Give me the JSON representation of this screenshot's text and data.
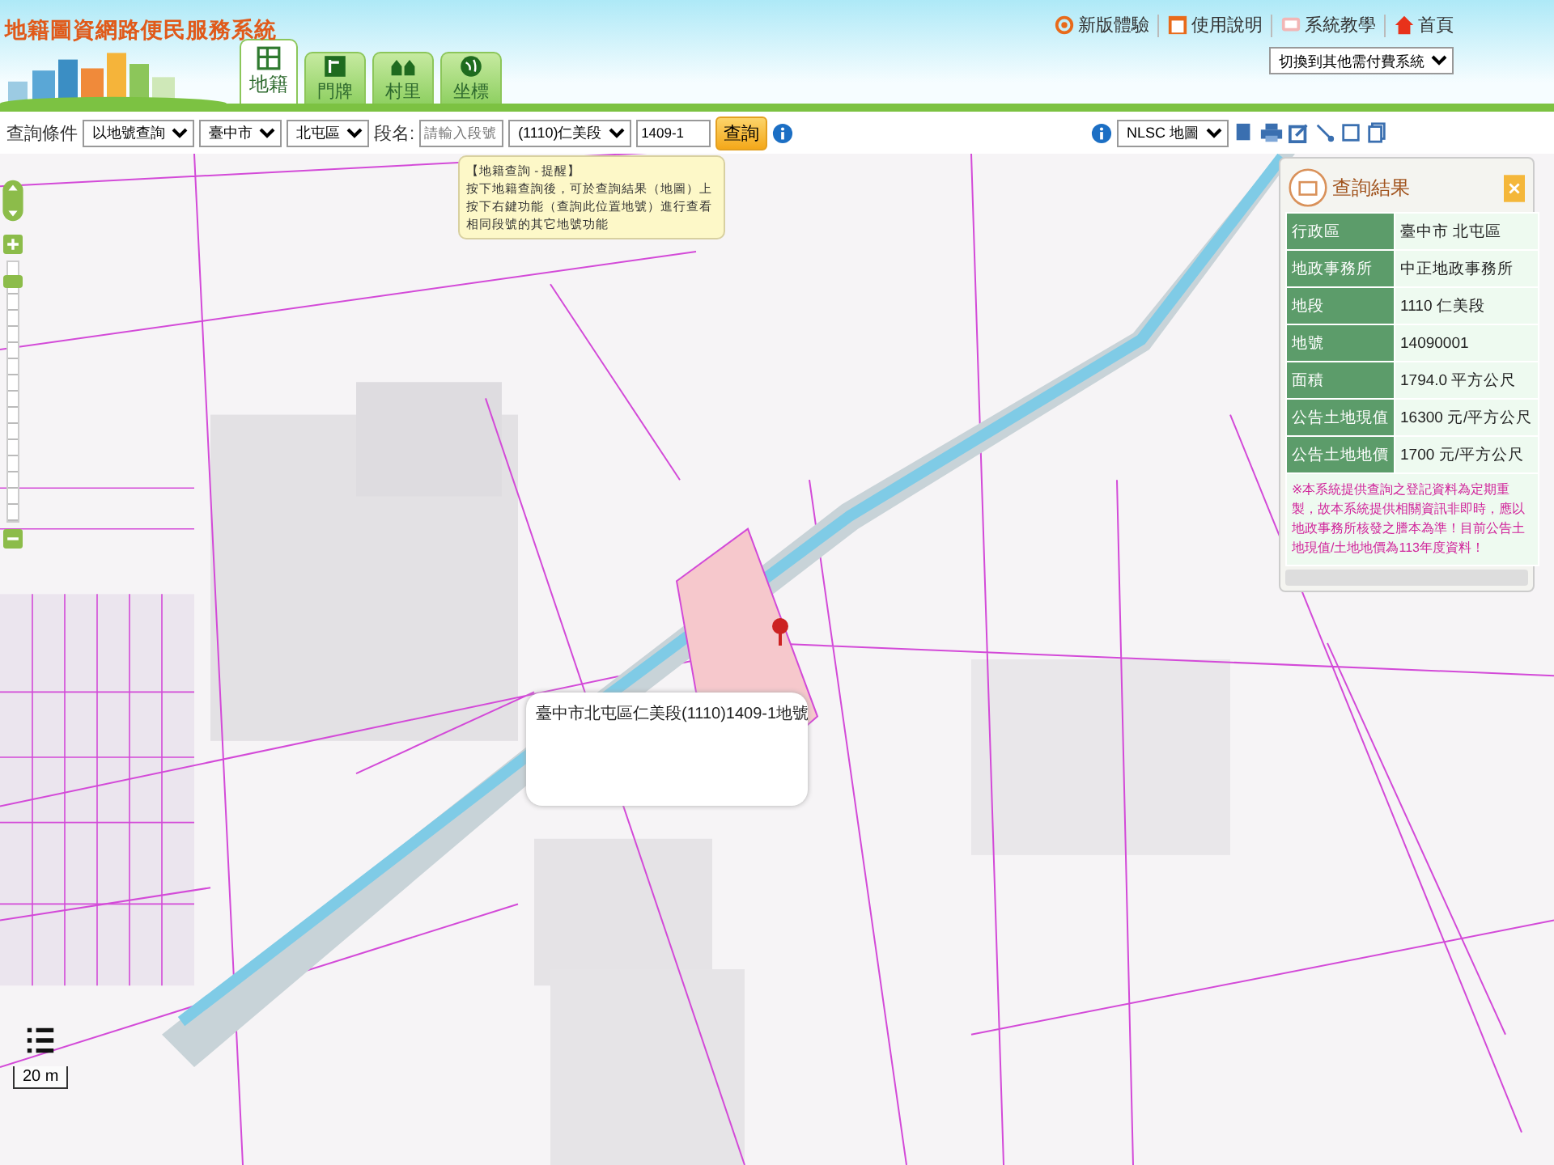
{
  "header": {
    "title": "地籍圖資網路便民服務系統",
    "links": [
      {
        "kind": "new",
        "label": "新版體驗"
      },
      {
        "kind": "help",
        "label": "使用說明"
      },
      {
        "kind": "tutorial",
        "label": "系統教學"
      },
      {
        "kind": "home",
        "label": "首頁"
      }
    ],
    "system_select": "切換到其他需付費系統"
  },
  "tabs": [
    {
      "kind": "parcel",
      "label": "地籍",
      "selected": true
    },
    {
      "kind": "doorplate",
      "label": "門牌",
      "selected": false
    },
    {
      "kind": "village",
      "label": "村里",
      "selected": false
    },
    {
      "kind": "coordinate",
      "label": "坐標",
      "selected": false
    }
  ],
  "query_bar": {
    "label": "查詢條件",
    "mode": "以地號查詢",
    "city": "臺中市",
    "district": "北屯區",
    "section_label": "段名:",
    "section_placeholder": "請輸入段號",
    "section": "(1110)仁美段",
    "parcel": "1409-1",
    "button": "查詢"
  },
  "basemap": "NLSC 地圖",
  "tooltip": {
    "title": "【地籍查詢 - 提醒】",
    "text": "按下地籍查詢後，可於查詢結果（地圖）上按下右鍵功能（查詢此位置地號）進行查看相同段號的其它地號功能"
  },
  "results": {
    "title": "查詢結果",
    "rows": [
      {
        "label": "行政區",
        "value": "臺中市 北屯區"
      },
      {
        "label": "地政事務所",
        "value": "中正地政事務所"
      },
      {
        "label": "地段",
        "value": "1110 仁美段"
      },
      {
        "label": "地號",
        "value": "14090001"
      },
      {
        "label": "面積",
        "value": "1794.0 平方公尺"
      },
      {
        "label": "公告土地現值",
        "value": "16300 元/平方公尺"
      },
      {
        "label": "公告土地地價",
        "value": "1700 元/平方公尺"
      }
    ],
    "note": "※本系統提供查詢之登記資料為定期重製，故本系統提供相關資訊非即時，應以地政事務所核發之謄本為準！目前公告土地現值/土地地價為113年度資料！"
  },
  "popup": {
    "text": "臺中市北屯區仁美段(1110)1409-1地號"
  },
  "scale": "20 m",
  "zoom": {
    "level": 0.95
  }
}
